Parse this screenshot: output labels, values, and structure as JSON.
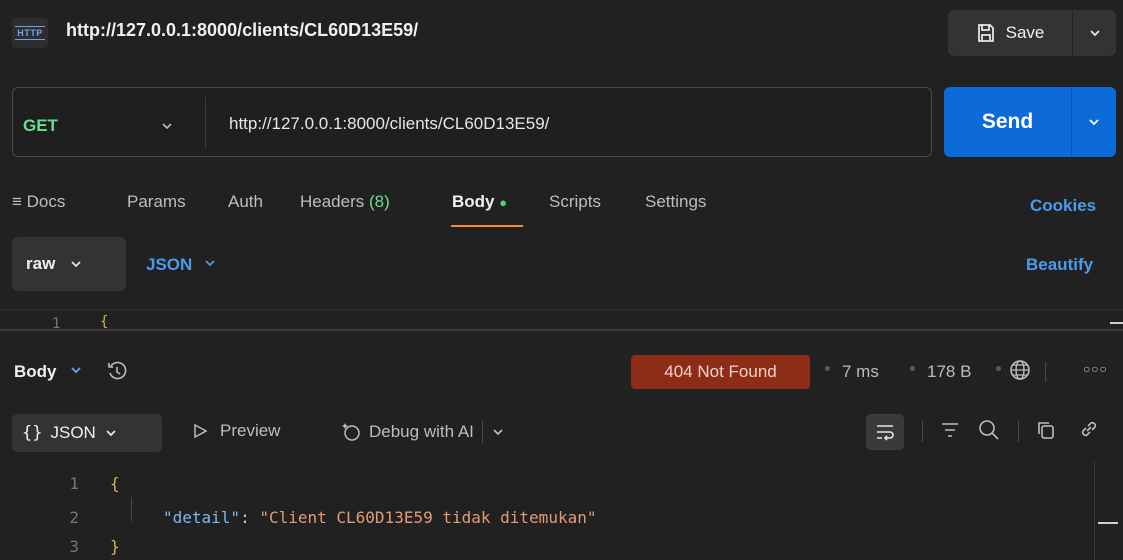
{
  "tab": {
    "badge": "HTTP",
    "title": "http://127.0.0.1:8000/clients/CL60D13E59/"
  },
  "save": {
    "label": "Save"
  },
  "request": {
    "method": "GET",
    "url": "http://127.0.0.1:8000/clients/CL60D13E59/",
    "send_label": "Send"
  },
  "request_tabs": {
    "docs": "Docs",
    "params": "Params",
    "auth": "Auth",
    "headers": "Headers",
    "headers_count": "(8)",
    "body": "Body",
    "scripts": "Scripts",
    "settings": "Settings",
    "cookies": "Cookies"
  },
  "body_options": {
    "mode": "raw",
    "format": "JSON",
    "beautify": "Beautify"
  },
  "request_editor": {
    "line_numbers": [
      "1"
    ],
    "first_line": "{"
  },
  "response": {
    "body_label": "Body",
    "status": "404 Not Found",
    "time": "7 ms",
    "size": "178 B",
    "format": "JSON",
    "format_icon": "{}",
    "preview_label": "Preview",
    "debug_label": "Debug with AI",
    "lines": [
      {
        "n": "1",
        "text": "{"
      },
      {
        "n": "2",
        "key": "\"detail\"",
        "colon": ": ",
        "value": "\"Client CL60D13E59 tidak ditemukan\""
      },
      {
        "n": "3",
        "text": "}"
      }
    ]
  },
  "colors": {
    "accent_blue": "#0c6bd8",
    "link_blue": "#4a9bf0",
    "method_green": "#6bdd8f",
    "status_error_bg": "#8d2d17",
    "active_tab_underline": "#f28c36"
  }
}
